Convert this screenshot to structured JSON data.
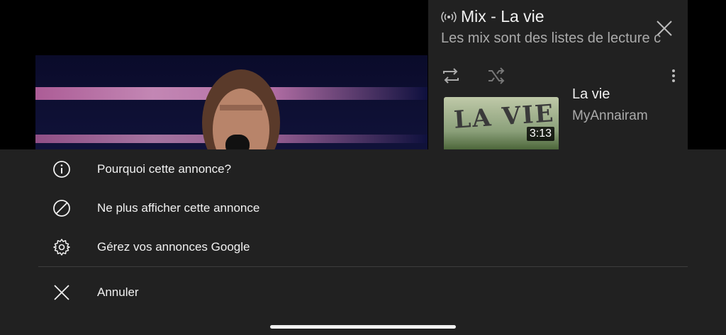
{
  "playlist": {
    "title": "Mix - La vie",
    "subtitle": "Les mix sont des listes de lecture c",
    "item": {
      "title": "La vie",
      "channel": "MyAnnairam",
      "duration": "3:13",
      "thumbnail_text": "LA VIE"
    }
  },
  "menu": {
    "items": [
      {
        "label": "Pourquoi cette annonce?",
        "icon": "info-icon"
      },
      {
        "label": "Ne plus afficher cette annonce",
        "icon": "block-icon"
      },
      {
        "label": "Gérez vos annonces Google",
        "icon": "gear-icon"
      },
      {
        "label": "Annuler",
        "icon": "close-icon"
      }
    ]
  },
  "colors": {
    "background": "#000000",
    "sheet": "#212121",
    "text_primary": "#f1f1f1",
    "text_secondary": "#aaaaaa"
  }
}
